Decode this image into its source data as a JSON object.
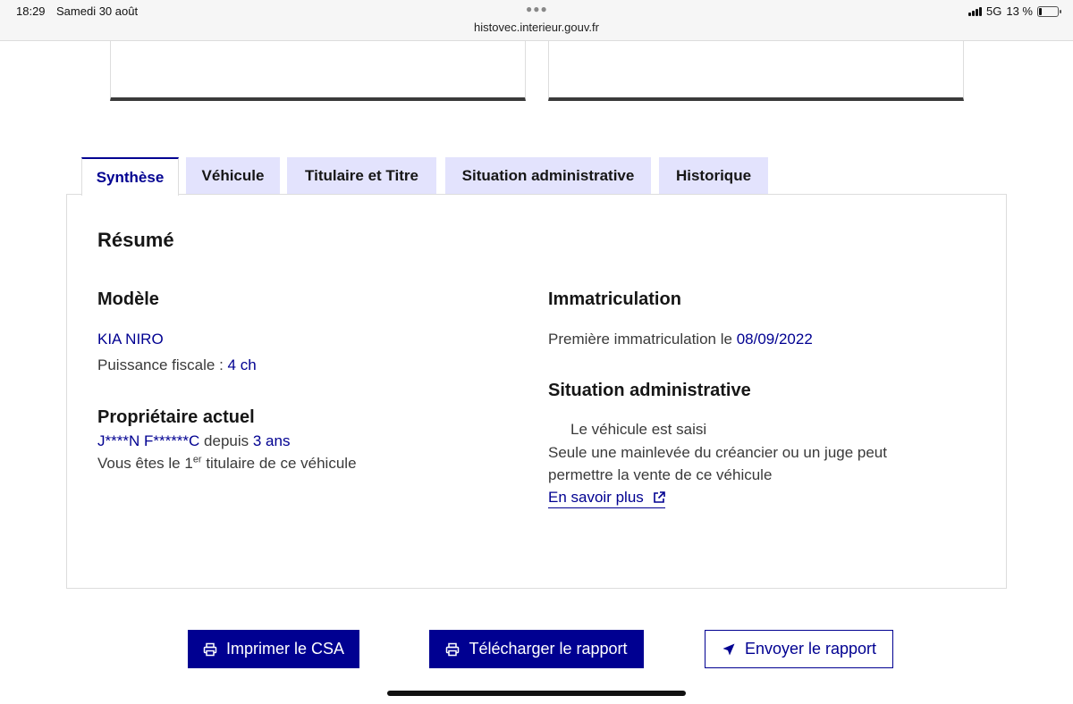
{
  "statusbar": {
    "time": "18:29",
    "date": "Samedi 30 août",
    "url": "histovec.interieur.gouv.fr",
    "network": "5G",
    "battery": "13 %",
    "battery_level": 0.13
  },
  "tabs": [
    {
      "label": "Synthèse",
      "active": true
    },
    {
      "label": "Véhicule",
      "active": false
    },
    {
      "label": "Titulaire et Titre",
      "active": false
    },
    {
      "label": "Situation administrative",
      "active": false
    },
    {
      "label": "Historique",
      "active": false
    }
  ],
  "summary": {
    "title": "Résumé",
    "model": {
      "heading": "Modèle",
      "name": "KIA NIRO",
      "power_label": "Puissance fiscale : ",
      "power_value": "4 ch"
    },
    "owner": {
      "heading": "Propriétaire actuel",
      "name": "J****N F******C",
      "since_label": " depuis ",
      "since_value": "3 ans",
      "holder_prefix": "Vous êtes le 1",
      "holder_sup": "er",
      "holder_suffix": " titulaire de ce véhicule"
    },
    "registration": {
      "heading": "Immatriculation",
      "first_label": "Première immatriculation le ",
      "first_date": "08/09/2022"
    },
    "admin": {
      "heading": "Situation administrative",
      "status": "Le véhicule est saisi",
      "line1": "Seule une mainlevée du créancier ou un juge peut",
      "line2": "permettre la vente de ce véhicule",
      "more_link": "En savoir plus"
    }
  },
  "actions": {
    "print_csa": "Imprimer le CSA",
    "download_report": "Télécharger le rapport",
    "send_report": "Envoyer le rapport"
  },
  "icons": {
    "print": "printer-icon",
    "send": "send-icon",
    "external": "external-link-icon"
  },
  "colors": {
    "primary": "#000091",
    "tab_bg": "#e3e3fd",
    "text": "#3a3a3a"
  }
}
